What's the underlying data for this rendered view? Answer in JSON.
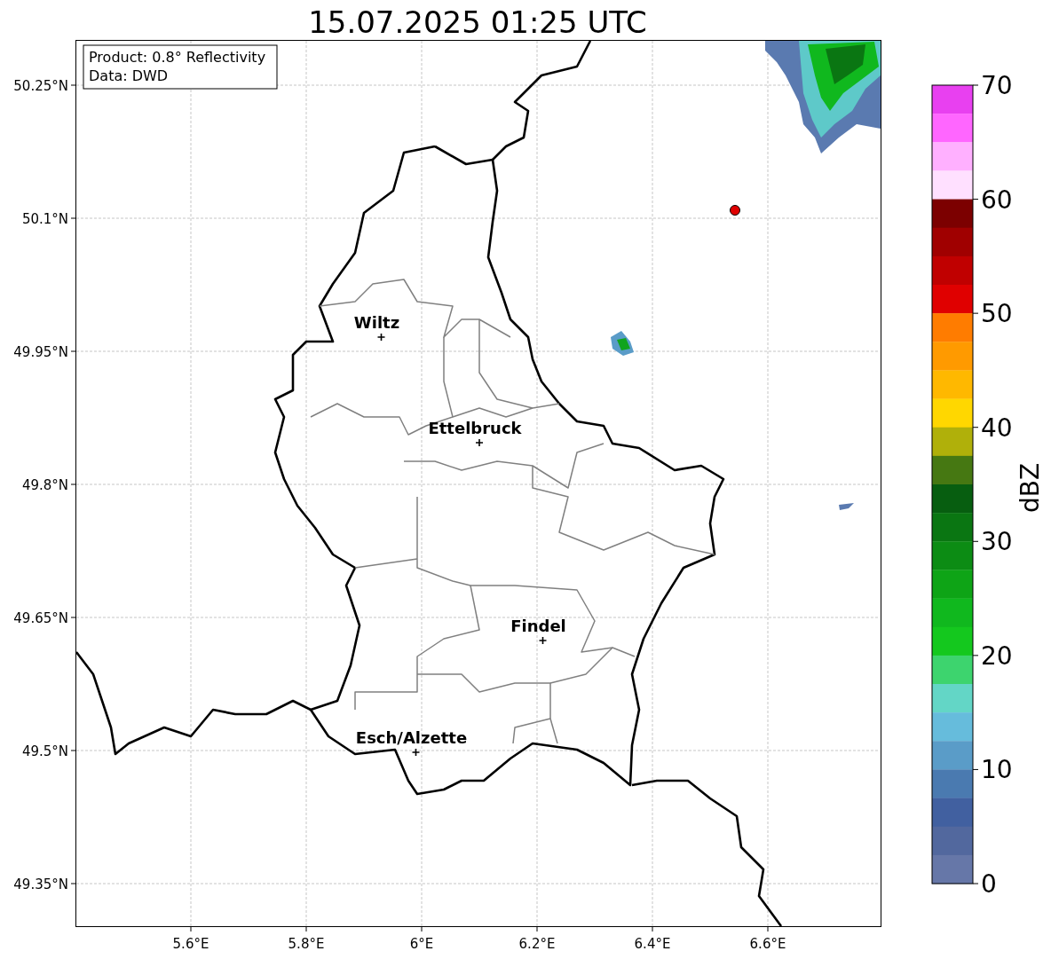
{
  "title": "15.07.2025 01:25 UTC",
  "info_box": [
    "Product: 0.8° Reflectivity",
    "Data: DWD"
  ],
  "map": {
    "lat_ticks": [
      "50.25°N",
      "50.1°N",
      "49.95°N",
      "49.8°N",
      "49.65°N",
      "49.5°N",
      "49.35°N"
    ],
    "lon_ticks": [
      "5.6°E",
      "5.8°E",
      "6°E",
      "6.2°E",
      "6.4°E",
      "6.6°E"
    ],
    "places": [
      {
        "name": "Wiltz"
      },
      {
        "name": "Ettelbruck"
      },
      {
        "name": "Findel"
      },
      {
        "name": "Esch/Alzette"
      }
    ]
  },
  "colorbar": {
    "label": "dBZ",
    "ticks": [
      "70",
      "60",
      "50",
      "40",
      "30",
      "20",
      "10",
      "0"
    ],
    "bins": [
      {
        "color": "#e840f0"
      },
      {
        "color": "#ff66ff"
      },
      {
        "color": "#ffb0ff"
      },
      {
        "color": "#ffe0ff"
      },
      {
        "color": "#7c0000"
      },
      {
        "color": "#a00000"
      },
      {
        "color": "#c00000"
      },
      {
        "color": "#e00000"
      },
      {
        "color": "#ff7c00"
      },
      {
        "color": "#ff9a00"
      },
      {
        "color": "#ffb800"
      },
      {
        "color": "#ffd700"
      },
      {
        "color": "#b0b00a"
      },
      {
        "color": "#467812"
      },
      {
        "color": "#075e10"
      },
      {
        "color": "#0a7612"
      },
      {
        "color": "#0c8c14"
      },
      {
        "color": "#0ea416"
      },
      {
        "color": "#10b81e"
      },
      {
        "color": "#14c81e"
      },
      {
        "color": "#3dd46e"
      },
      {
        "color": "#63d6c6"
      },
      {
        "color": "#66bcdc"
      },
      {
        "color": "#5a9cc8"
      },
      {
        "color": "#4a7ab0"
      },
      {
        "color": "#4160a0"
      },
      {
        "color": "#52689e"
      },
      {
        "color": "#6677a8"
      }
    ]
  }
}
